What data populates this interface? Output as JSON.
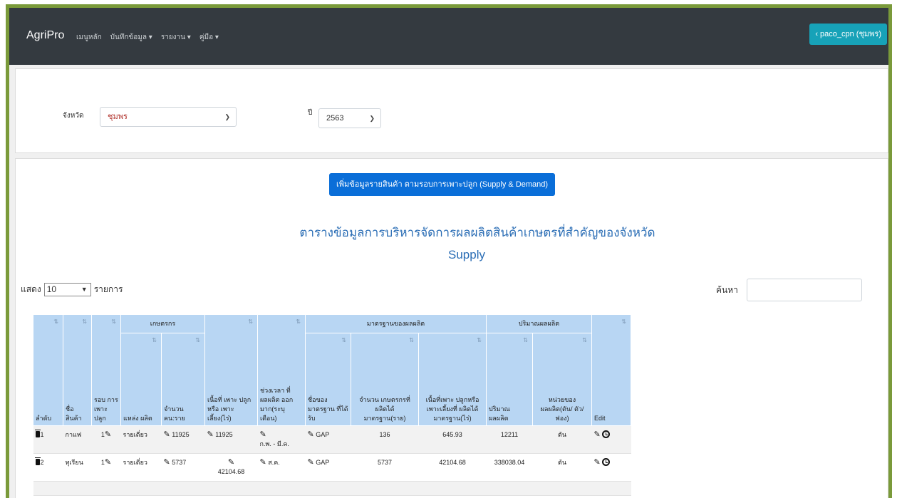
{
  "navbar": {
    "brand": "AgriPro",
    "menu": [
      "เมนูหลัก",
      "บันทึกข้อมูล ▾",
      "รายงาน ▾",
      "คู่มือ ▾"
    ],
    "user": "‹ paco_cpn (ชุมพร)"
  },
  "filter": {
    "province_label": "จังหวัด",
    "province_value": "ชุมพร",
    "year_label": "ปี",
    "year_value": "2563"
  },
  "main": {
    "add_button": "เพิ่มข้อมูลรายสินค้า ตามรอบการเพาะปลูก (Supply & Demand)",
    "title_line1": "ตารางข้อมูลการบริหารจัดการผลผลิตสินค้าเกษตรที่สำคัญของจังหวัด",
    "title_line2": "Supply",
    "show_label": "แสดง",
    "show_value": "10",
    "show_suffix": "รายการ",
    "search_label": "ค้นหา"
  },
  "table": {
    "group_headers": {
      "farmer": "เกษตรกร",
      "standard": "มาตรฐานของผลผลิต",
      "quantity": "ปริมาณผลผลิต"
    },
    "columns": {
      "order": "ลำดับ",
      "product": "ชื่อ สินค้า",
      "round": "รอบ การ เพาะ ปลูก",
      "source": "แหล่ง ผลิต",
      "count": "จำนวน คน:ราย",
      "area": "เนื้อที่ เพาะ ปลูกหรือ เพาะ เลี้ยง(ไร่)",
      "period": "ช่วงเวลา ที่ ผลผลิต ออก มาก(ระบุ เดือน)",
      "std_name": "ชื่อของ มาตรฐาน ที่ได้รับ",
      "std_farmers": "จำนวน เกษตรกรที่ ผลิตได้ มาตรฐาน(ราย)",
      "std_area": "เนื้อที่เพาะ ปลูกหรือ เพาะเลี้ยงที่ ผลิตได้ มาตรฐาน(ไร่)",
      "qty": "ปริมาณ ผลผลิต",
      "unit": "หน่วยของ ผลผลิต(ตัน/ ตัว/ฟอง)",
      "edit": "Edit"
    },
    "rows": [
      {
        "order": "1",
        "product": "กาแฟ",
        "round": "1",
        "source": "รายเดี่ยว",
        "count": "11925",
        "area": "11925",
        "period": "ก.พ. - มี.ค.",
        "std_name": "GAP",
        "std_farmers": "136",
        "std_area": "645.93",
        "qty": "12211",
        "unit": "ตัน"
      },
      {
        "order": "2",
        "product": "ทุเรียน",
        "round": "1",
        "source": "รายเดี่ยว",
        "count": "5737",
        "area": "42104.68",
        "period": "ส.ค.",
        "std_name": "GAP",
        "std_farmers": "5737",
        "std_area": "42104.68",
        "qty": "338038.04",
        "unit": "ตัน"
      }
    ]
  }
}
